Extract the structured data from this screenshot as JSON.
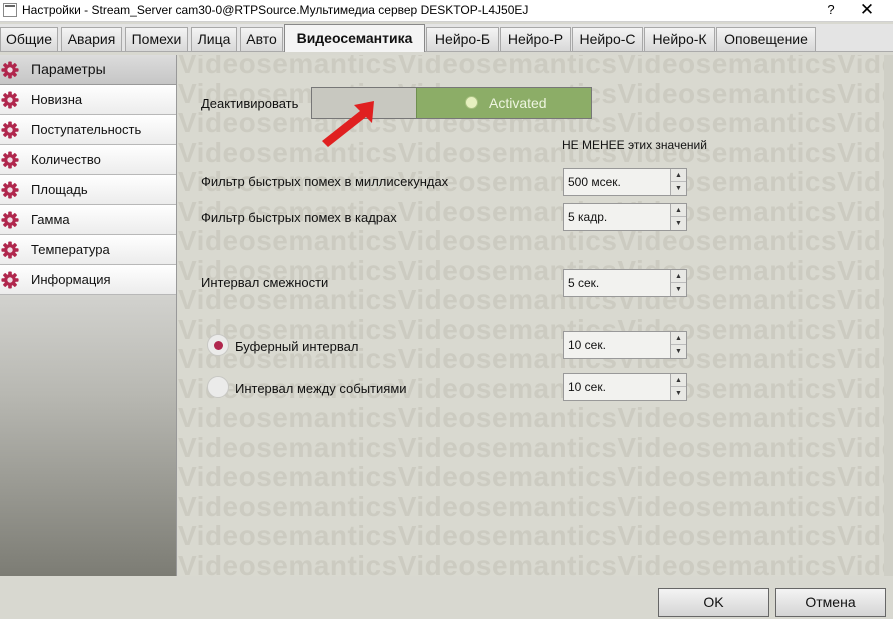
{
  "window": {
    "title": "Настройки - Stream_Server cam30-0@RTPSource.Мультимедиа сервер DESKTOP-L4J50EJ",
    "help": "?",
    "close": "✕"
  },
  "tabs": [
    {
      "label": "Общие"
    },
    {
      "label": "Авария"
    },
    {
      "label": "Помехи"
    },
    {
      "label": "Лица"
    },
    {
      "label": "Авто"
    },
    {
      "label": "Видеосемантика"
    },
    {
      "label": "Нейро-Б"
    },
    {
      "label": "Нейро-Р"
    },
    {
      "label": "Нейро-С"
    },
    {
      "label": "Нейро-К"
    },
    {
      "label": "Оповещение"
    }
  ],
  "sidebar": {
    "items": [
      {
        "label": "Параметры",
        "icon": "gear-icon"
      },
      {
        "label": "Новизна",
        "icon": "gear-icon"
      },
      {
        "label": "Поступательность",
        "icon": "gear-icon"
      },
      {
        "label": "Количество",
        "icon": "gear-icon"
      },
      {
        "label": "Площадь",
        "icon": "gear-icon"
      },
      {
        "label": "Гамма",
        "icon": "gear-icon"
      },
      {
        "label": "Температура",
        "icon": "gear-icon"
      },
      {
        "label": "Информация",
        "icon": "gear-icon"
      }
    ],
    "active": "Параметры"
  },
  "main": {
    "watermark": "Videosemantics",
    "deactivate_label": "Деактивировать",
    "toggle": {
      "state_label": "Activated"
    },
    "header_note": "НЕ МЕНЕЕ этих значений",
    "fields": {
      "fast_noise_ms": {
        "label": "Фильтр быстрых помех в миллисекундах",
        "value": "500 мсек."
      },
      "fast_noise_frames": {
        "label": "Фильтр быстрых помех в кадрах",
        "value": "5 кадр."
      },
      "adjacency": {
        "label": "Интервал смежности",
        "value": "5 сек."
      },
      "buffer": {
        "label": "Буферный интервал",
        "value": "10 сек.",
        "selected": true
      },
      "between_events": {
        "label": "Интервал между событиями",
        "value": "10 сек.",
        "selected": false
      }
    }
  },
  "buttons": {
    "ok": "OK",
    "cancel": "Отмена"
  },
  "colors": {
    "accent_gear": "#b0274d",
    "toggle_on": "#8cad67",
    "arrow": "#e02020"
  }
}
